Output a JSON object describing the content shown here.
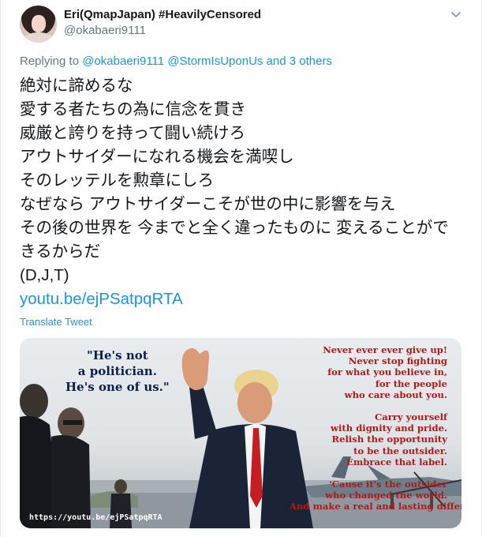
{
  "user": {
    "display_name": "Eri(QmapJapan) #HeavilyCensored",
    "handle": "@okabaeri9111"
  },
  "reply": {
    "prefix": "Replying to",
    "mention1": "@okabaeri9111",
    "mention2": "@StormIsUponUs",
    "suffix": "and 3 others"
  },
  "tweet": {
    "lines": [
      "絶対に諦めるな",
      "愛する者たちの為に信念を貫き",
      "威厳と誇りを持って闘い続けろ",
      "アウトサイダーになれる機会を満喫し",
      "そのレッテルを勲章にしろ",
      "なぜなら アウトサイダーこそが世の中に影響を与え",
      "その後の世界を 今までと全く違ったものに 変えることがで",
      "きるからだ",
      "(D,J,T)"
    ],
    "link": "youtu.be/ejPSatpqRTA",
    "translate_label": "Translate Tweet"
  },
  "card": {
    "quote_lines": [
      "\"He's not",
      "a politician.",
      "He's one of us.\""
    ],
    "right_lines": [
      "Never ever ever give up!",
      "Never stop fighting",
      "for what you believe in,",
      "for the people",
      "who care about you.",
      "",
      "Carry yourself",
      "with dignity and pride.",
      "Relish the opportunity",
      "to be the outsider.",
      "Embrace that label.",
      "",
      "'Cause it's the outsider",
      "who changed the world.",
      "And make a real and lasting difference."
    ],
    "url": "https://youtu.be/ejPSatpqRTA"
  },
  "icons": {
    "menu": "chevron-down-icon"
  },
  "colors": {
    "link": "#1b95e0",
    "secondary": "#657786",
    "quote": "#0a1f4a",
    "red_text": "#b21818"
  }
}
